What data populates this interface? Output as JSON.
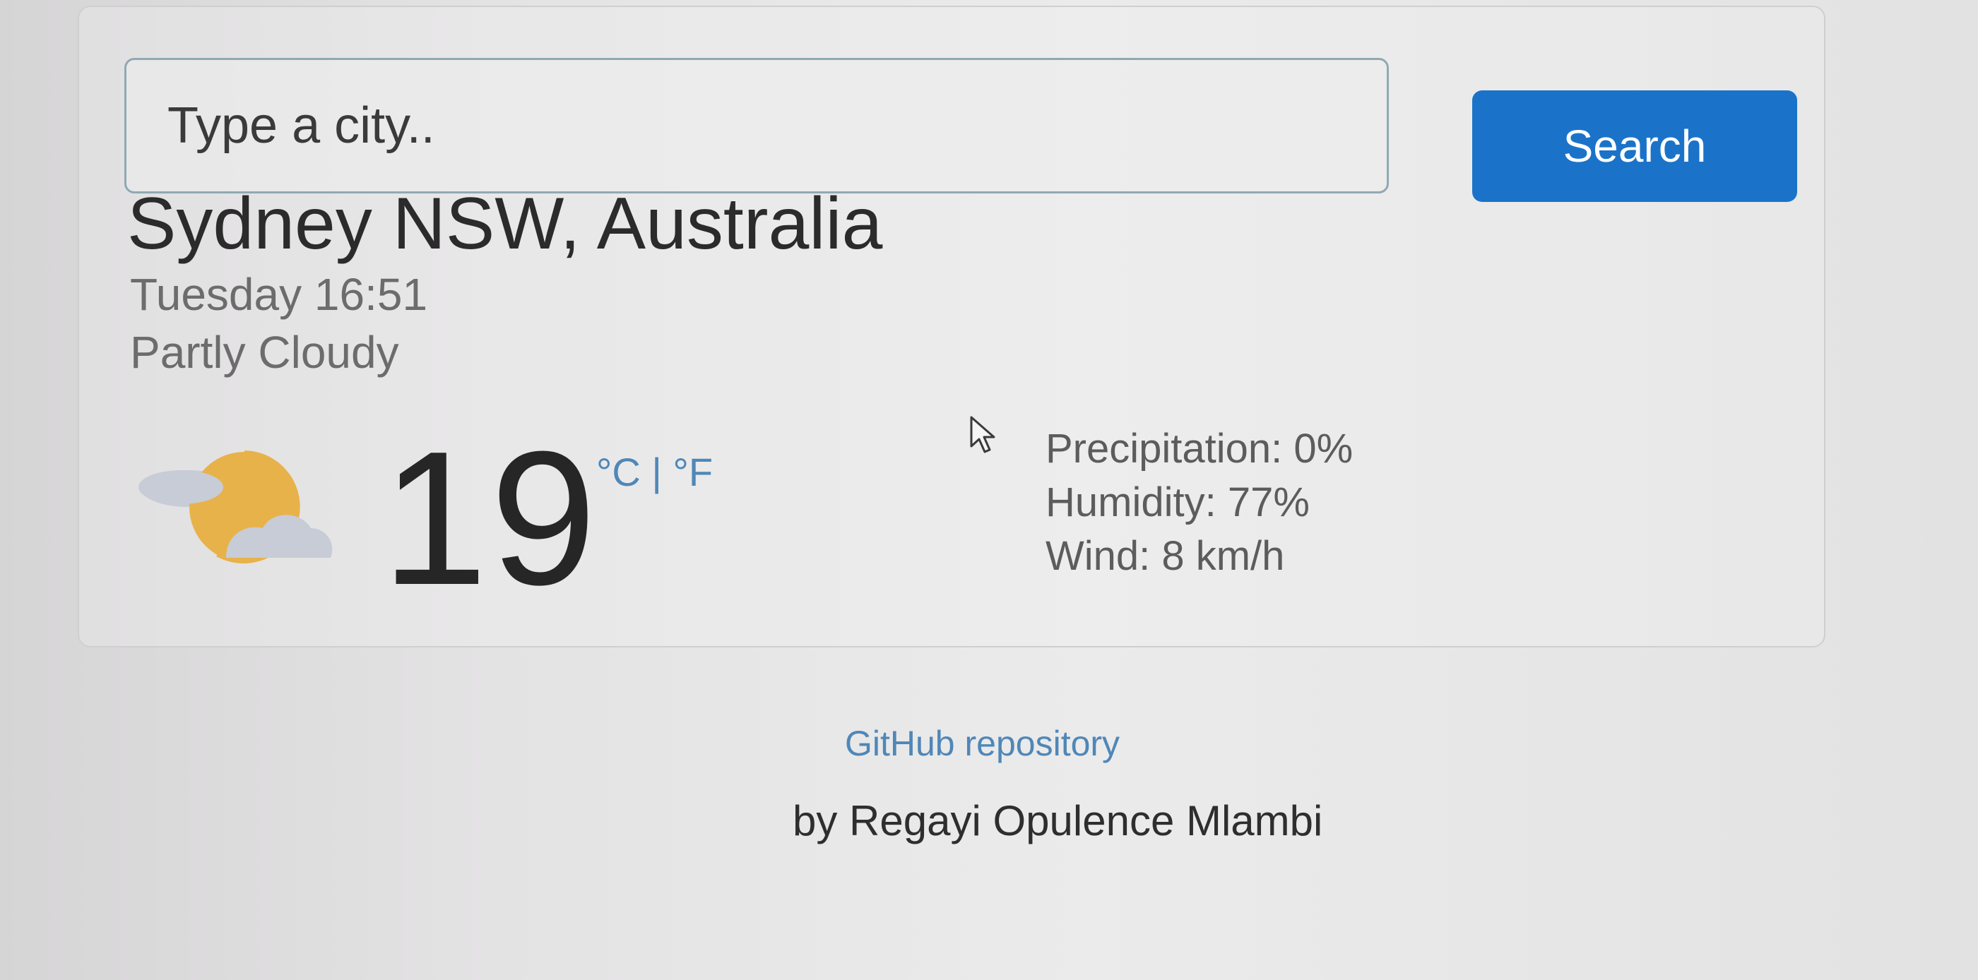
{
  "search": {
    "placeholder": "Type a city..",
    "button_label": "Search"
  },
  "weather": {
    "city": "Sydney NSW, Australia",
    "datetime": "Tuesday 16:51",
    "condition": "Partly Cloudy",
    "temperature": "19",
    "unit_celsius": "°C",
    "unit_separator": " | ",
    "unit_fahrenheit": "°F",
    "icon": "partly-cloudy-icon",
    "precipitation": "Precipitation: 0%",
    "humidity": "Humidity: 77%",
    "wind": "Wind: 8 km/h"
  },
  "footer": {
    "github_link": "GitHub repository",
    "author": "by Regayi Opulence Mlambi"
  },
  "colors": {
    "button": "#1a73c9",
    "link": "#4f87b8",
    "sun": "#e8b24a",
    "cloud": "#c7ccd6"
  }
}
